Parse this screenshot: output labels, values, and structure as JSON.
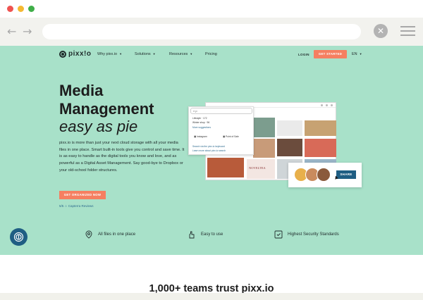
{
  "nav": {
    "items": [
      "Why pixx.io",
      "Solutions",
      "Resources",
      "Pricing"
    ],
    "login": "LOGIN",
    "get_started": "GET STARTED",
    "lang": "EN"
  },
  "brand": {
    "logo_text": "pixx!o"
  },
  "hero": {
    "title_line1": "Media",
    "title_line2": "Management",
    "title_line3": "easy as pie",
    "intro": "pixx.io is more than just your next cloud storage with all your media files in one place. Smart built-in tools give you control and save time. It is as easy to handle as the digital tools you know and love, and as powerful as a Digital Asset Management. Say good-bye to Dropbox or your old-school folder structures.",
    "cta": "GET ORGANIZED NOW",
    "reviews": "5/5 ☆ Capterra Reviews"
  },
  "mockup": {
    "search_value": "p",
    "suggestions": [
      "Lifestyle",
      "Winter shop"
    ],
    "suggestion_counts": [
      "172",
      "96"
    ],
    "more_label": "More suggestions",
    "chips": [
      "Instagram",
      "Point of Sale"
    ],
    "links": [
      "Search via the pixx.io keyboard",
      "Learn more about pixx.io search"
    ],
    "share": "SHARE",
    "tile_label": "NOVELTEA"
  },
  "features": [
    {
      "label": "All files in one place",
      "icon": "location-pin-icon"
    },
    {
      "label": "Easy to use",
      "icon": "hand-icon"
    },
    {
      "label": "Highest Security Standards",
      "icon": "shield-badge-icon"
    }
  ],
  "trust": {
    "heading": "1,000+ teams trust pixx.io"
  },
  "colors": {
    "hero_bg": "#a8e1c9",
    "accent": "#f57f61",
    "dark_blue": "#1f5e83"
  }
}
